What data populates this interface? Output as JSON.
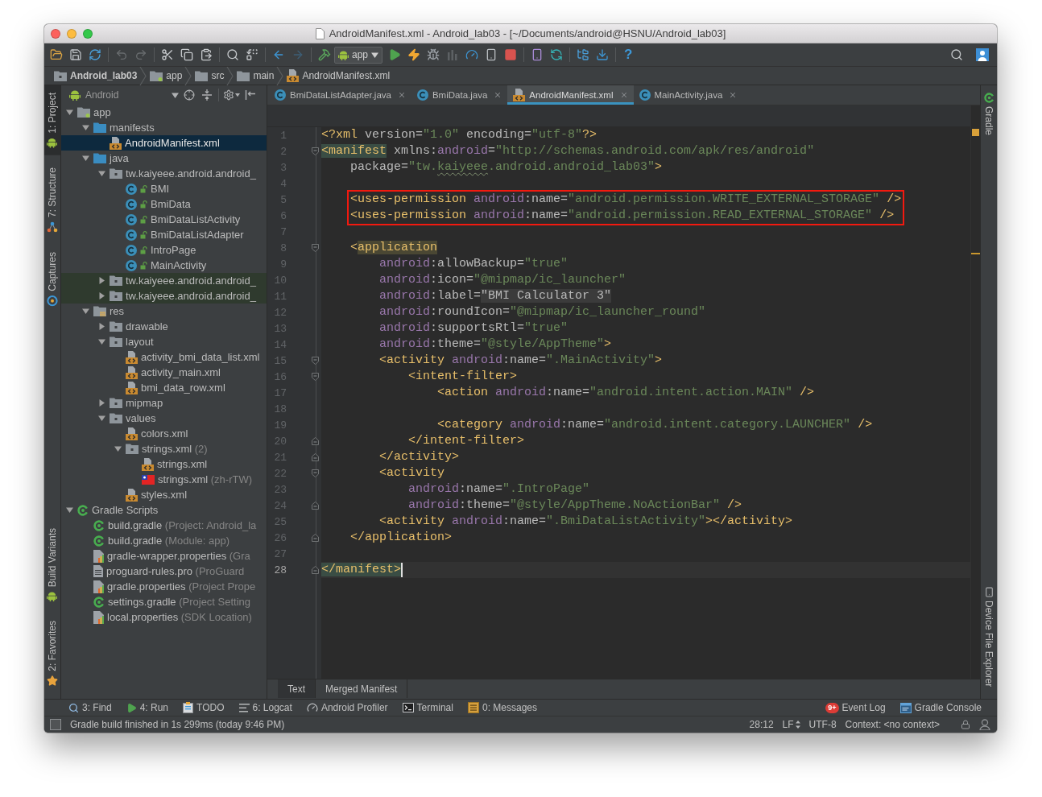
{
  "window": {
    "title": "AndroidManifest.xml - Android_lab03 - [~/Documents/android@HSNU/Android_lab03]"
  },
  "toolbar": {
    "groups": [
      [
        {
          "kind": "open",
          "disabled": false
        },
        {
          "kind": "save",
          "disabled": false
        },
        {
          "kind": "sync",
          "disabled": false
        }
      ],
      [
        {
          "kind": "undo",
          "disabled": true
        },
        {
          "kind": "redo",
          "disabled": true
        }
      ],
      [
        {
          "kind": "cut",
          "disabled": false
        },
        {
          "kind": "copy",
          "disabled": false
        },
        {
          "kind": "paste",
          "disabled": false
        }
      ],
      [
        {
          "kind": "find",
          "disabled": false
        },
        {
          "kind": "replace",
          "disabled": false
        }
      ],
      [
        {
          "kind": "back",
          "disabled": false
        },
        {
          "kind": "forward",
          "disabled": true
        }
      ],
      [
        {
          "kind": "make",
          "disabled": false
        },
        {
          "kind": "run-config",
          "label": "app",
          "disabled": false
        },
        {
          "kind": "run",
          "disabled": false
        },
        {
          "kind": "apply-changes",
          "disabled": false
        },
        {
          "kind": "debug",
          "disabled": false
        },
        {
          "kind": "attach",
          "disabled": true
        },
        {
          "kind": "profile",
          "disabled": false
        },
        {
          "kind": "apply-code",
          "disabled": false
        },
        {
          "kind": "stop",
          "disabled": false
        }
      ],
      [
        {
          "kind": "avd",
          "disabled": false
        },
        {
          "kind": "sync-gradle",
          "disabled": false
        }
      ],
      [
        {
          "kind": "structure",
          "disabled": false
        },
        {
          "kind": "sdk",
          "disabled": false
        }
      ],
      [
        {
          "kind": "help",
          "label": "?",
          "disabled": false
        }
      ]
    ]
  },
  "breadcrumbs": [
    {
      "label": "Android_lab03",
      "kind": "project"
    },
    {
      "label": "app",
      "kind": "module"
    },
    {
      "label": "src",
      "kind": "plain-folder"
    },
    {
      "label": "main",
      "kind": "plain-folder"
    },
    {
      "label": "AndroidManifest.xml",
      "kind": "xml-file"
    }
  ],
  "left_strip": {
    "top": [
      {
        "label": "1: Project",
        "kind": "project",
        "selected": true
      },
      {
        "label": "7: Structure",
        "kind": "structure",
        "selected": false
      },
      {
        "label": "Captures",
        "kind": "captures",
        "selected": false
      }
    ],
    "bottom": [
      {
        "label": "Build Variants",
        "kind": "build-variants",
        "selected": false
      },
      {
        "label": "2: Favorites",
        "kind": "favorites",
        "selected": false
      }
    ]
  },
  "project_panel": {
    "view": "Android",
    "tree": [
      {
        "label": "app",
        "kind": "module",
        "expanded": true,
        "selected": false,
        "children": [
          {
            "label": "manifests",
            "kind": "blue-folder",
            "expanded": true,
            "selected": false,
            "children": [
              {
                "label": "AndroidManifest.xml",
                "kind": "xml-file",
                "selected": true
              }
            ]
          },
          {
            "label": "java",
            "kind": "blue-folder",
            "expanded": true,
            "selected": false,
            "children": [
              {
                "label": "tw.kaiyeee.android.android_",
                "kind": "package",
                "expanded": true,
                "selected": false,
                "children": [
                  {
                    "label": "BMI",
                    "kind": "class",
                    "selected": false
                  },
                  {
                    "label": "BmiData",
                    "kind": "class",
                    "selected": false
                  },
                  {
                    "label": "BmiDataListActivity",
                    "kind": "class",
                    "selected": false
                  },
                  {
                    "label": "BmiDataListAdapter",
                    "kind": "class",
                    "selected": false
                  },
                  {
                    "label": "IntroPage",
                    "kind": "class",
                    "selected": false
                  },
                  {
                    "label": "MainActivity",
                    "kind": "class",
                    "selected": false
                  }
                ]
              },
              {
                "label": "tw.kaiyeee.android.android_",
                "kind": "test-package",
                "expanded": false,
                "selected": false
              },
              {
                "label": "tw.kaiyeee.android.android_",
                "kind": "test-package",
                "expanded": false,
                "selected": false
              }
            ]
          },
          {
            "label": "res",
            "kind": "res-folder",
            "expanded": true,
            "selected": false,
            "children": [
              {
                "label": "drawable",
                "kind": "folder",
                "expanded": false,
                "selected": false
              },
              {
                "label": "layout",
                "kind": "folder",
                "expanded": true,
                "selected": false,
                "children": [
                  {
                    "label": "activity_bmi_data_list.xml",
                    "kind": "xml-file",
                    "selected": false
                  },
                  {
                    "label": "activity_main.xml",
                    "kind": "xml-file",
                    "selected": false
                  },
                  {
                    "label": "bmi_data_row.xml",
                    "kind": "xml-file",
                    "selected": false
                  }
                ]
              },
              {
                "label": "mipmap",
                "kind": "folder",
                "expanded": false,
                "selected": false
              },
              {
                "label": "values",
                "kind": "folder",
                "expanded": true,
                "selected": false,
                "children": [
                  {
                    "label": "colors.xml",
                    "kind": "xml-file",
                    "selected": false
                  },
                  {
                    "label": "strings.xml",
                    "note": "(2)",
                    "kind": "folder",
                    "expanded": true,
                    "selected": false,
                    "children": [
                      {
                        "label": "strings.xml",
                        "kind": "xml-file",
                        "selected": false
                      },
                      {
                        "label": "strings.xml",
                        "note": "(zh-rTW)",
                        "kind": "flag-xml",
                        "selected": false
                      }
                    ]
                  },
                  {
                    "label": "styles.xml",
                    "kind": "xml-file",
                    "selected": false
                  }
                ]
              }
            ]
          }
        ]
      },
      {
        "label": "Gradle Scripts",
        "kind": "gradle",
        "expanded": true,
        "selected": false,
        "children": [
          {
            "label": "build.gradle",
            "note": "(Project: Android_la",
            "kind": "gradle",
            "selected": false
          },
          {
            "label": "build.gradle",
            "note": "(Module: app)",
            "kind": "gradle",
            "selected": false
          },
          {
            "label": "gradle-wrapper.properties",
            "note": "(Gra",
            "kind": "properties",
            "selected": false
          },
          {
            "label": "proguard-rules.pro",
            "note": "(ProGuard",
            "kind": "text-file",
            "selected": false
          },
          {
            "label": "gradle.properties",
            "note": "(Project Prope",
            "kind": "properties",
            "selected": false
          },
          {
            "label": "settings.gradle",
            "note": "(Project Setting",
            "kind": "gradle",
            "selected": false
          },
          {
            "label": "local.properties",
            "note": "(SDK Location)",
            "kind": "properties",
            "selected": false
          }
        ]
      }
    ]
  },
  "editor": {
    "tabs": [
      {
        "label": "BmiDataListAdapter.java",
        "kind": "class",
        "selected": false
      },
      {
        "label": "BmiData.java",
        "kind": "class",
        "selected": false
      },
      {
        "label": "AndroidManifest.xml",
        "kind": "xml-file",
        "selected": true
      },
      {
        "label": "MainActivity.java",
        "kind": "class",
        "selected": false
      }
    ],
    "lines": [
      {
        "number": "1",
        "boxed": false,
        "current": false,
        "tokens": [
          {
            "kind": "tag",
            "text": "<?xml"
          },
          {
            "kind": "attr",
            "text": " version="
          },
          {
            "kind": "value",
            "text": "\"1.0\""
          },
          {
            "kind": "attr",
            "text": " encoding="
          },
          {
            "kind": "value",
            "text": "\"utf-8\""
          },
          {
            "kind": "tag",
            "text": "?>"
          }
        ]
      },
      {
        "number": "2",
        "fold_marker": {
          "kind": "start"
        },
        "boxed": false,
        "current": false,
        "tokens": [
          {
            "kind": "tag-match",
            "text": "<manifest"
          },
          {
            "kind": "attr",
            "text": " xmlns:"
          },
          {
            "kind": "ns",
            "text": "android"
          },
          {
            "kind": "attr",
            "text": "="
          },
          {
            "kind": "value",
            "text": "\"http://schemas.android.com/apk/res/android\""
          }
        ]
      },
      {
        "number": "3",
        "boxed": false,
        "current": false,
        "tokens": [
          {
            "kind": "attr",
            "text": "    package="
          },
          {
            "kind": "value",
            "text": "\"tw."
          },
          {
            "kind": "value-typo",
            "text": "kaiyeee"
          },
          {
            "kind": "value",
            "text": ".android.android_lab03\""
          },
          {
            "kind": "tag",
            "text": ">"
          }
        ]
      },
      {
        "number": "4",
        "boxed": false,
        "current": false
      },
      {
        "number": "5",
        "boxed": true,
        "current": false,
        "tokens": [
          {
            "kind": "tag",
            "text": "    <uses-permission"
          },
          {
            "kind": "ns",
            "text": " android"
          },
          {
            "kind": "attr",
            "text": ":name="
          },
          {
            "kind": "value",
            "text": "\"android.permission.WRITE_EXTERNAL_STORAGE\""
          },
          {
            "kind": "tag",
            "text": " />"
          }
        ]
      },
      {
        "number": "6",
        "boxed": true,
        "current": false,
        "tokens": [
          {
            "kind": "tag",
            "text": "    <uses-permission"
          },
          {
            "kind": "ns",
            "text": " android"
          },
          {
            "kind": "attr",
            "text": ":name="
          },
          {
            "kind": "value",
            "text": "\"android.permission.READ_EXTERNAL_STORAGE\""
          },
          {
            "kind": "tag",
            "text": " />"
          }
        ]
      },
      {
        "number": "7",
        "boxed": false,
        "current": false
      },
      {
        "number": "8",
        "fold_marker": {
          "kind": "start"
        },
        "boxed": false,
        "current": false,
        "tokens": [
          {
            "kind": "tag",
            "text": "    <"
          },
          {
            "kind": "tag-mark",
            "text": "application"
          }
        ]
      },
      {
        "number": "9",
        "boxed": false,
        "current": false,
        "tokens": [
          {
            "kind": "ns",
            "text": "        android"
          },
          {
            "kind": "attr",
            "text": ":allowBackup="
          },
          {
            "kind": "value",
            "text": "\"true\""
          }
        ]
      },
      {
        "number": "10",
        "boxed": false,
        "current": false,
        "tokens": [
          {
            "kind": "ns",
            "text": "        android"
          },
          {
            "kind": "attr",
            "text": ":icon="
          },
          {
            "kind": "value",
            "text": "\"@mipmap/ic_launcher\""
          }
        ]
      },
      {
        "number": "11",
        "boxed": false,
        "current": false,
        "tokens": [
          {
            "kind": "ns",
            "text": "        android"
          },
          {
            "kind": "attr",
            "text": ":label="
          },
          {
            "kind": "folded",
            "text": "\"BMI Calculator 3\""
          }
        ]
      },
      {
        "number": "12",
        "boxed": false,
        "current": false,
        "tokens": [
          {
            "kind": "ns",
            "text": "        android"
          },
          {
            "kind": "attr",
            "text": ":roundIcon="
          },
          {
            "kind": "value",
            "text": "\"@mipmap/ic_launcher_round\""
          }
        ]
      },
      {
        "number": "13",
        "boxed": false,
        "current": false,
        "tokens": [
          {
            "kind": "ns",
            "text": "        android"
          },
          {
            "kind": "attr",
            "text": ":supportsRtl="
          },
          {
            "kind": "value",
            "text": "\"true\""
          }
        ]
      },
      {
        "number": "14",
        "boxed": false,
        "current": false,
        "tokens": [
          {
            "kind": "ns",
            "text": "        android"
          },
          {
            "kind": "attr",
            "text": ":theme="
          },
          {
            "kind": "value",
            "text": "\"@style/AppTheme\""
          },
          {
            "kind": "tag",
            "text": ">"
          }
        ]
      },
      {
        "number": "15",
        "fold_marker": {
          "kind": "start"
        },
        "boxed": false,
        "current": false,
        "tokens": [
          {
            "kind": "tag",
            "text": "        <activity"
          },
          {
            "kind": "ns",
            "text": " android"
          },
          {
            "kind": "attr",
            "text": ":name="
          },
          {
            "kind": "value",
            "text": "\".MainActivity\""
          },
          {
            "kind": "tag",
            "text": ">"
          }
        ]
      },
      {
        "number": "16",
        "fold_marker": {
          "kind": "start"
        },
        "boxed": false,
        "current": false,
        "tokens": [
          {
            "kind": "tag",
            "text": "            <intent-filter>"
          }
        ]
      },
      {
        "number": "17",
        "boxed": false,
        "current": false,
        "tokens": [
          {
            "kind": "tag",
            "text": "                <action"
          },
          {
            "kind": "ns",
            "text": " android"
          },
          {
            "kind": "attr",
            "text": ":name="
          },
          {
            "kind": "value",
            "text": "\"android.intent.action.MAIN\""
          },
          {
            "kind": "tag",
            "text": " />"
          }
        ]
      },
      {
        "number": "18",
        "boxed": false,
        "current": false
      },
      {
        "number": "19",
        "boxed": false,
        "current": false,
        "tokens": [
          {
            "kind": "tag",
            "text": "                <category"
          },
          {
            "kind": "ns",
            "text": " android"
          },
          {
            "kind": "attr",
            "text": ":name="
          },
          {
            "kind": "value",
            "text": "\"android.intent.category.LAUNCHER\""
          },
          {
            "kind": "tag",
            "text": " />"
          }
        ]
      },
      {
        "number": "20",
        "fold_marker": {
          "kind": "end"
        },
        "boxed": false,
        "current": false,
        "tokens": [
          {
            "kind": "tag",
            "text": "            </intent-filter>"
          }
        ]
      },
      {
        "number": "21",
        "fold_marker": {
          "kind": "end"
        },
        "boxed": false,
        "current": false,
        "tokens": [
          {
            "kind": "tag",
            "text": "        </activity>"
          }
        ]
      },
      {
        "number": "22",
        "fold_marker": {
          "kind": "start"
        },
        "boxed": false,
        "current": false,
        "tokens": [
          {
            "kind": "tag",
            "text": "        <activity"
          }
        ]
      },
      {
        "number": "23",
        "boxed": false,
        "current": false,
        "tokens": [
          {
            "kind": "ns",
            "text": "            android"
          },
          {
            "kind": "attr",
            "text": ":name="
          },
          {
            "kind": "value",
            "text": "\".IntroPage\""
          }
        ]
      },
      {
        "number": "24",
        "fold_marker": {
          "kind": "end"
        },
        "boxed": false,
        "current": false,
        "tokens": [
          {
            "kind": "ns",
            "text": "            android"
          },
          {
            "kind": "attr",
            "text": ":theme="
          },
          {
            "kind": "value",
            "text": "\"@style/AppTheme.NoActionBar\""
          },
          {
            "kind": "tag",
            "text": " />"
          }
        ]
      },
      {
        "number": "25",
        "boxed": false,
        "current": false,
        "tokens": [
          {
            "kind": "tag",
            "text": "        <activity"
          },
          {
            "kind": "ns",
            "text": " android"
          },
          {
            "kind": "attr",
            "text": ":name="
          },
          {
            "kind": "value",
            "text": "\".BmiDataListActivity\""
          },
          {
            "kind": "tag",
            "text": "></activity>"
          }
        ]
      },
      {
        "number": "26",
        "fold_marker": {
          "kind": "end"
        },
        "boxed": false,
        "current": false,
        "tokens": [
          {
            "kind": "tag",
            "text": "    </application>"
          }
        ]
      },
      {
        "number": "27",
        "boxed": false,
        "current": false
      },
      {
        "number": "28",
        "fold_marker": {
          "kind": "end"
        },
        "boxed": false,
        "current": true,
        "tokens": [
          {
            "kind": "tag-match",
            "text": "</manifest>"
          }
        ]
      }
    ],
    "bottom_tabs": [
      {
        "label": "Text",
        "selected": true
      },
      {
        "label": "Merged Manifest",
        "selected": false
      }
    ]
  },
  "right_strip": {
    "top": [
      {
        "label": "Gradle",
        "kind": "gradle"
      }
    ],
    "bottom": [
      {
        "label": "Device File Explorer",
        "kind": "device"
      }
    ]
  },
  "tool_window_bar": {
    "left": [
      {
        "label": "3: Find",
        "kind": "find"
      },
      {
        "label": "4: Run",
        "kind": "run"
      },
      {
        "label": "TODO",
        "kind": "todo"
      },
      {
        "label": "6: Logcat",
        "kind": "logcat"
      },
      {
        "label": "Android Profiler",
        "kind": "profiler"
      },
      {
        "label": "Terminal",
        "kind": "terminal"
      },
      {
        "label": "0: Messages",
        "kind": "messages"
      }
    ],
    "right": [
      {
        "label": "Event Log",
        "kind": "event-log",
        "badge": "9+"
      },
      {
        "label": "Gradle Console",
        "kind": "gradle-console"
      }
    ]
  },
  "status_bar": {
    "message": "Gradle build finished in 1s 299ms (today 9:46 PM)",
    "position": "28:12",
    "line_separator": "LF",
    "encoding": "UTF-8",
    "context": "Context: <no context>"
  }
}
